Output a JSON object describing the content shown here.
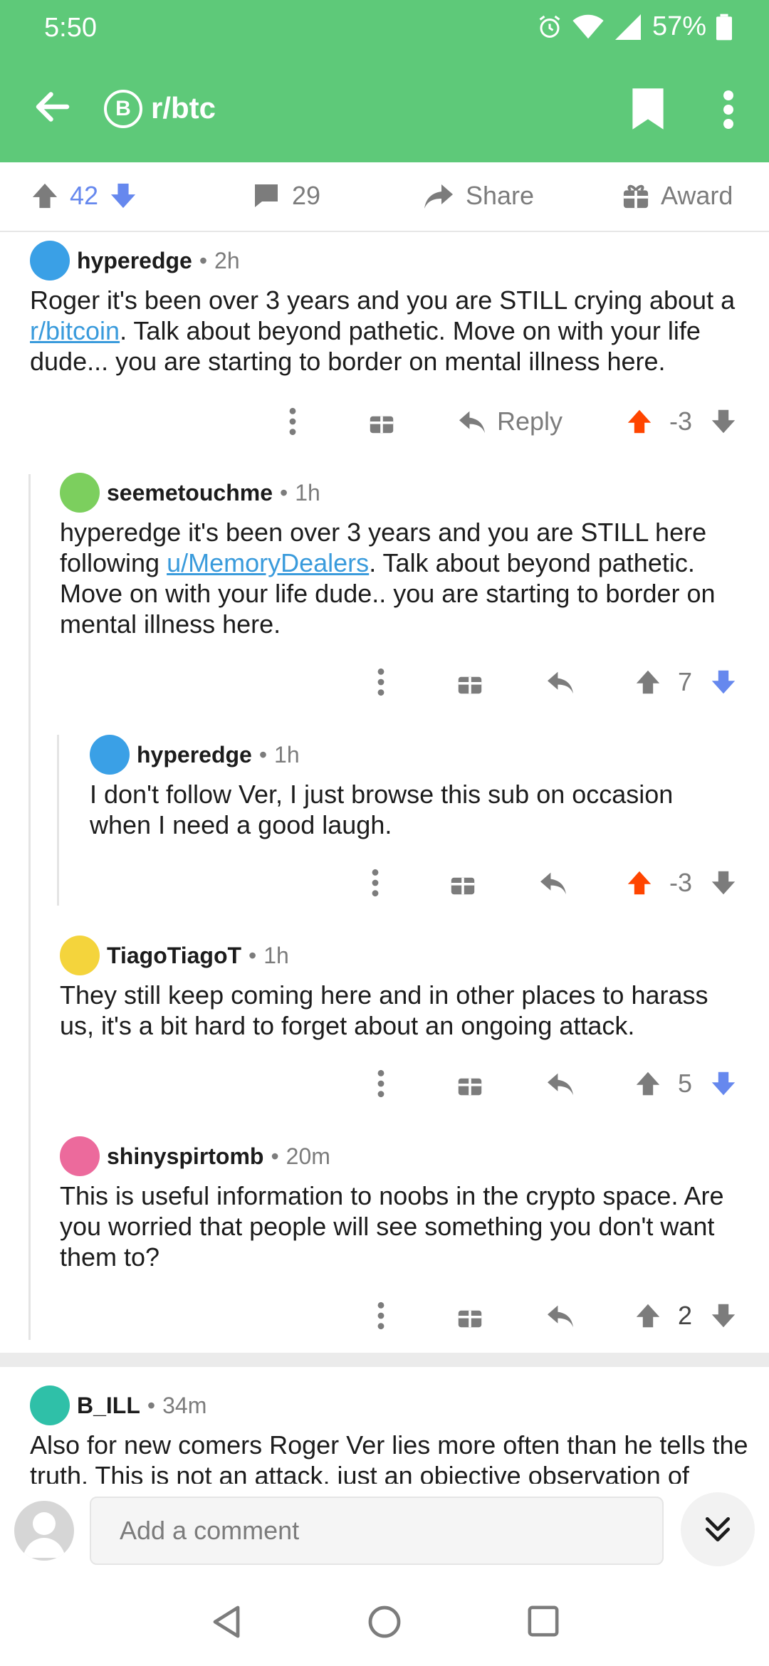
{
  "status_bar": {
    "time": "5:50",
    "battery": "57%"
  },
  "header": {
    "subreddit": "r/btc",
    "sub_icon_letter": "B"
  },
  "post_actions": {
    "score": "42",
    "comments": "29",
    "share_label": "Share",
    "award_label": "Award"
  },
  "comments": [
    {
      "user": "hyperedge",
      "age": "2h",
      "body_before": "Roger it's been over 3 years and you are STILL crying about a ",
      "link": "r/bitcoin",
      "body_after": ". Talk about beyond pathetic. Move on with your life dude... you are starting to border on mental illness here.",
      "reply_label": "Reply",
      "score": "-3"
    },
    {
      "user": "seemetouchme",
      "age": "1h",
      "body_before": "hyperedge it's been over 3 years and you are STILL here following ",
      "link": "u/MemoryDealers",
      "body_after": ". Talk about beyond pathetic. Move on with your life dude.. you are starting to border on mental illness here.",
      "score": "7"
    },
    {
      "user": "hyperedge",
      "age": "1h",
      "body": "I don't follow Ver, I just browse this sub on occasion when I need a good laugh.",
      "score": "-3"
    },
    {
      "user": "TiagoTiagoT",
      "age": "1h",
      "body": "They still keep coming here and in other places to harass us, it's a bit hard to forget about an ongoing attack.",
      "score": "5"
    },
    {
      "user": "shinyspirtomb",
      "age": "20m",
      "body": "This is useful information to noobs in the crypto space. Are you worried that people will see something you don't want them to?",
      "score": "2"
    },
    {
      "user": "B_ILL",
      "age": "34m",
      "body": "Also for new comers Roger Ver lies more often than he tells the truth. This is not an attack, just an objective observation of"
    }
  ],
  "meta_sep": "•",
  "comment_input": {
    "placeholder": "Add a comment"
  },
  "colors": {
    "header": "#5ec979",
    "upvoted": "#ff4500",
    "downvoted": "#6688ee",
    "link": "#3a9bdc"
  }
}
